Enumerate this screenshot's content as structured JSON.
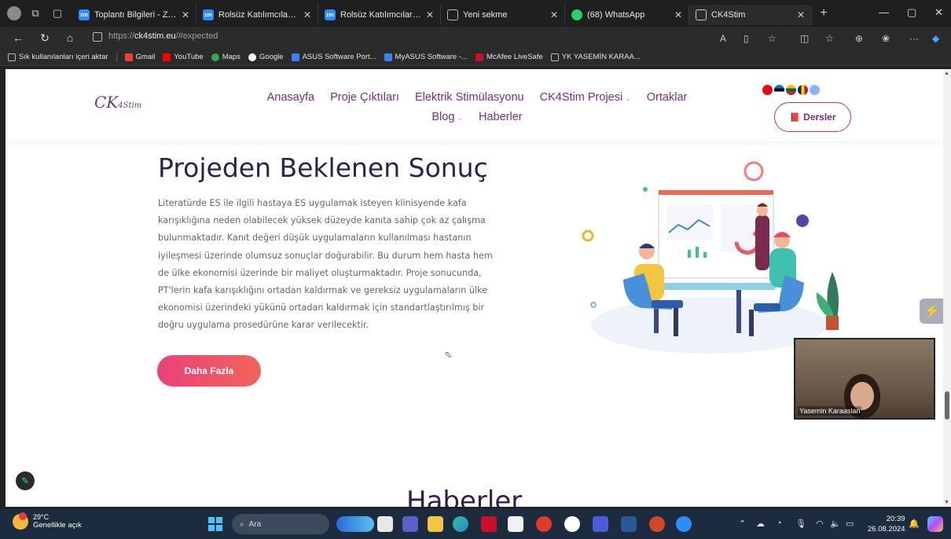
{
  "browser": {
    "tabs": [
      {
        "title": "Toplantı Bilgileri - Zoom",
        "favicon": "zoom-icon",
        "active": false
      },
      {
        "title": "Rolsüz Katılımcılar için Eti",
        "favicon": "zoom-icon",
        "active": false
      },
      {
        "title": "Rolsüz Katılımcılar için Eti",
        "favicon": "zoom-icon",
        "active": false
      },
      {
        "title": "Yeni sekme",
        "favicon": "newtab-icon",
        "active": false
      },
      {
        "title": "(68) WhatsApp",
        "favicon": "whatsapp-icon",
        "active": false
      },
      {
        "title": "CK4Stim",
        "favicon": "page-icon",
        "active": true
      }
    ],
    "url_prefix": "https://",
    "url_host": "ck4stim.eu",
    "url_path": "/#expected",
    "bookmarks": [
      {
        "label": "Sık kullanılanları içeri aktar",
        "color": "#bbbbbb"
      },
      {
        "label": "Gmail",
        "color": "#ea4335"
      },
      {
        "label": "YouTube",
        "color": "#ff0000"
      },
      {
        "label": "Maps",
        "color": "#34a853"
      },
      {
        "label": "Google",
        "color": "#ffffff"
      },
      {
        "label": "ASUS Software Port...",
        "color": "#3b82f6"
      },
      {
        "label": "MyASUS Software -...",
        "color": "#3b82f6"
      },
      {
        "label": "McAfee LiveSafe",
        "color": "#c8102e"
      },
      {
        "label": "YK YASEMİN KARAA...",
        "color": "#bbbbbb"
      }
    ]
  },
  "site": {
    "logo_text": "CK",
    "logo_sub": "4Stim",
    "nav_row1": [
      "Anasayfa",
      "Proje Çıktıları",
      "Elektrik Stimülasyonu",
      "CK4Stim Projesi",
      "Ortaklar"
    ],
    "nav_row2": [
      "Blog",
      "Haberler"
    ],
    "dersler_label": "Dersler",
    "flags": [
      "#e30a17",
      "#0072ce",
      "#ffcc00",
      "#fdb913",
      "#8ab4f8"
    ]
  },
  "content": {
    "title": "Projeden Beklenen Sonuç",
    "paragraph_lines": [
      "Literatürde ES ile ilgili hastaya ES uygulamak isteyen klinisyende kafa",
      "karışıklığına neden olabilecek yüksek düzeyde kanıta sahip çok az çalışma",
      "bulunmaktadır. Kanıt değeri düşük uygulamaların kullanılması hastanın",
      "iyileşmesi üzerinde olumsuz sonuçlar doğurabilir. Bu durum hem hasta hem",
      "de ülke ekonomisi üzerinde bir maliyet oluşturmaktadır. Proje sonucunda,",
      "PT'lerin kafa karışıklığını ortadan kaldırmak ve gereksiz uygulamaların ülke",
      "ekonomisi üzerindeki yükünü ortadan kaldırmak için standartlaştırılmış bir",
      "doğru uygulama prosedürüne karar verilecektir."
    ],
    "cta_label": "Daha Fazla",
    "next_section_title": "Haberler"
  },
  "video": {
    "participant_name": "Yasemin Karaaslan"
  },
  "taskbar": {
    "temperature": "29°C",
    "weather_text": "Genellikle açık",
    "search_placeholder": "Ara",
    "time": "20:39",
    "date": "26.08.2024"
  }
}
